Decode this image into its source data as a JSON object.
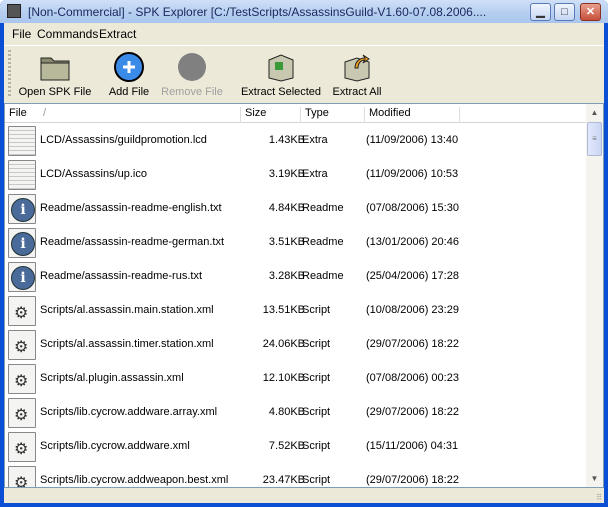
{
  "window": {
    "title": "[Non-Commercial] - SPK Explorer [C:/TestScripts/AssassinsGuild-V1.60-07.08.2006....",
    "minimize": "▁",
    "maximize": "□",
    "close": "✕"
  },
  "menu": [
    "File",
    "Commands",
    "Extract"
  ],
  "toolbar": [
    {
      "label": "Open SPK File",
      "icon": "folder-icon",
      "enabled": true
    },
    {
      "label": "Add File",
      "icon": "add-icon",
      "enabled": true
    },
    {
      "label": "Remove File",
      "icon": "remove-icon",
      "enabled": false
    },
    {
      "label": "Extract Selected",
      "icon": "extract-selected-icon",
      "enabled": true
    },
    {
      "label": "Extract All",
      "icon": "extract-all-icon",
      "enabled": true
    }
  ],
  "columns": {
    "file": "File",
    "sort": "/",
    "size": "Size",
    "type": "Type",
    "modified": "Modified"
  },
  "files": [
    {
      "name": "LCD/Assassins/guildpromotion.lcd",
      "size": "1.43KB",
      "type": "Extra",
      "modified": "(11/09/2006) 13:40",
      "icon": "extra"
    },
    {
      "name": "LCD/Assassins/up.ico",
      "size": "3.19KB",
      "type": "Extra",
      "modified": "(11/09/2006) 10:53",
      "icon": "extra"
    },
    {
      "name": "Readme/assassin-readme-english.txt",
      "size": "4.84KB",
      "type": "Readme",
      "modified": "(07/08/2006) 15:30",
      "icon": "info"
    },
    {
      "name": "Readme/assassin-readme-german.txt",
      "size": "3.51KB",
      "type": "Readme",
      "modified": "(13/01/2006) 20:46",
      "icon": "info"
    },
    {
      "name": "Readme/assassin-readme-rus.txt",
      "size": "3.28KB",
      "type": "Readme",
      "modified": "(25/04/2006) 17:28",
      "icon": "info"
    },
    {
      "name": "Scripts/al.assassin.main.station.xml",
      "size": "13.51KB",
      "type": "Script",
      "modified": "(10/08/2006) 23:29",
      "icon": "script"
    },
    {
      "name": "Scripts/al.assassin.timer.station.xml",
      "size": "24.06KB",
      "type": "Script",
      "modified": "(29/07/2006) 18:22",
      "icon": "script"
    },
    {
      "name": "Scripts/al.plugin.assassin.xml",
      "size": "12.10KB",
      "type": "Script",
      "modified": "(07/08/2006) 00:23",
      "icon": "script"
    },
    {
      "name": "Scripts/lib.cycrow.addware.array.xml",
      "size": "4.80KB",
      "type": "Script",
      "modified": "(29/07/2006) 18:22",
      "icon": "script"
    },
    {
      "name": "Scripts/lib.cycrow.addware.xml",
      "size": "7.52KB",
      "type": "Script",
      "modified": "(15/11/2006) 04:31",
      "icon": "script"
    },
    {
      "name": "Scripts/lib.cycrow.addweapon.best.xml",
      "size": "23.47KB",
      "type": "Script",
      "modified": "(29/07/2006) 18:22",
      "icon": "script"
    }
  ]
}
